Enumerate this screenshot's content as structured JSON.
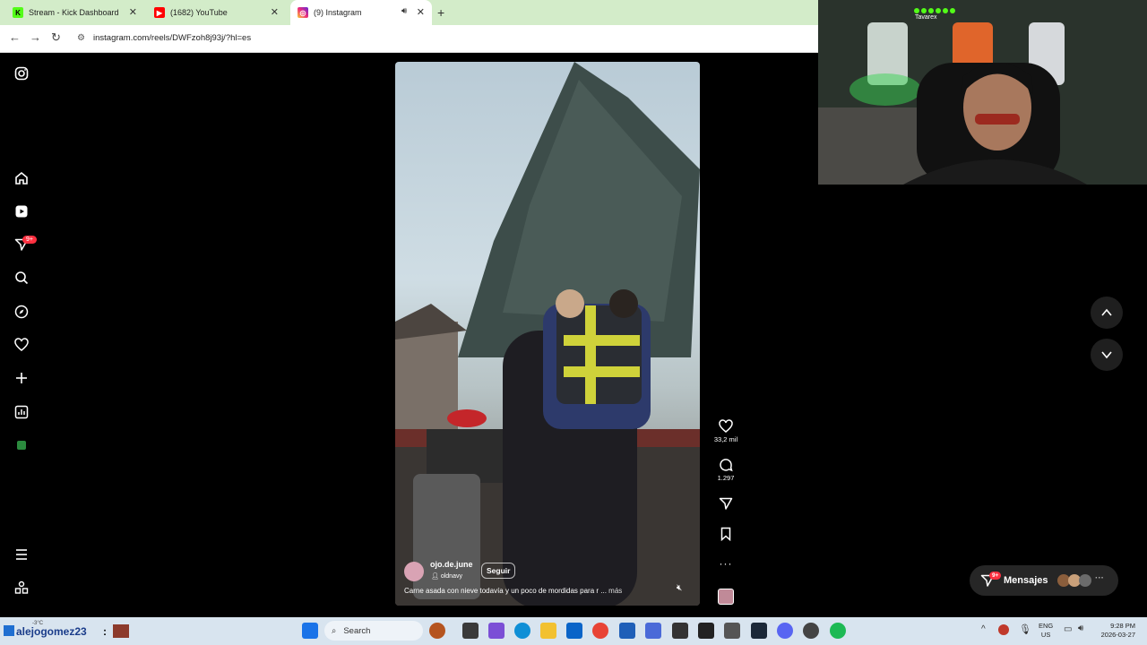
{
  "browser": {
    "tabs": [
      {
        "title": "Stream - Kick Dashboard",
        "icon": "kick-icon",
        "color": "#53fc18"
      },
      {
        "title": "(1682) YouTube",
        "icon": "youtube-icon",
        "color": "#ff0000"
      },
      {
        "title": "(9) Instagram",
        "icon": "instagram-icon",
        "color": "#e1306c"
      }
    ],
    "url": "instagram.com/reels/DWFzoh8j93j/?hl=es",
    "new_tab": "+"
  },
  "sidebar": {
    "notification_badge": "9+"
  },
  "reel": {
    "username": "ojo.de.june",
    "audio": "oldnavy",
    "follow_label": "Seguir",
    "caption": "Carne asada con nieve todavía y un poco de mordidas para r ...",
    "more_label": "más",
    "likes": "33,2 mil",
    "comments": "1.297"
  },
  "messages": {
    "label": "Mensajes",
    "badge": "9+"
  },
  "webcam": {
    "overlay_text": "Tavarex"
  },
  "taskbar": {
    "streamer_name": "alejogomez23",
    "temperature": "-3°C",
    "search_placeholder": "Search",
    "lang_line1": "ENG",
    "lang_line2": "US",
    "time": "9:28 PM",
    "date": "2026-03-27"
  },
  "colors": {
    "accent_green": "#53fc18",
    "badge_red": "#ff3040",
    "taskbar_bg": "#d8e4ef"
  }
}
